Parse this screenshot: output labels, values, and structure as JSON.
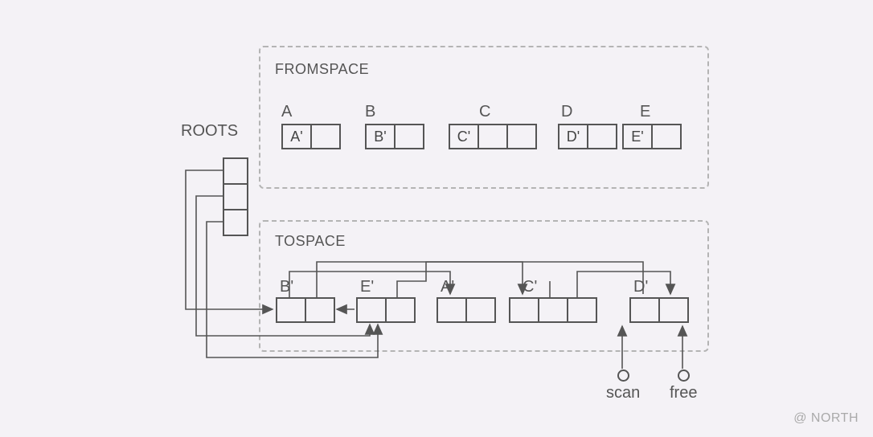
{
  "roots_label": "ROOTS",
  "fromspace": {
    "title": "FROMSPACE",
    "objects": [
      {
        "name": "A",
        "ptr": "A'"
      },
      {
        "name": "B",
        "ptr": "B'"
      },
      {
        "name": "C",
        "ptr": "C'"
      },
      {
        "name": "D",
        "ptr": "D'"
      },
      {
        "name": "E",
        "ptr": "E'"
      }
    ]
  },
  "tospace": {
    "title": "TOSPACE",
    "objects": [
      {
        "name": "B'"
      },
      {
        "name": "E'"
      },
      {
        "name": "A'"
      },
      {
        "name": "C'"
      },
      {
        "name": "D'"
      }
    ]
  },
  "pointers": {
    "scan": "scan",
    "free": "free"
  },
  "credit": "@ NORTH"
}
